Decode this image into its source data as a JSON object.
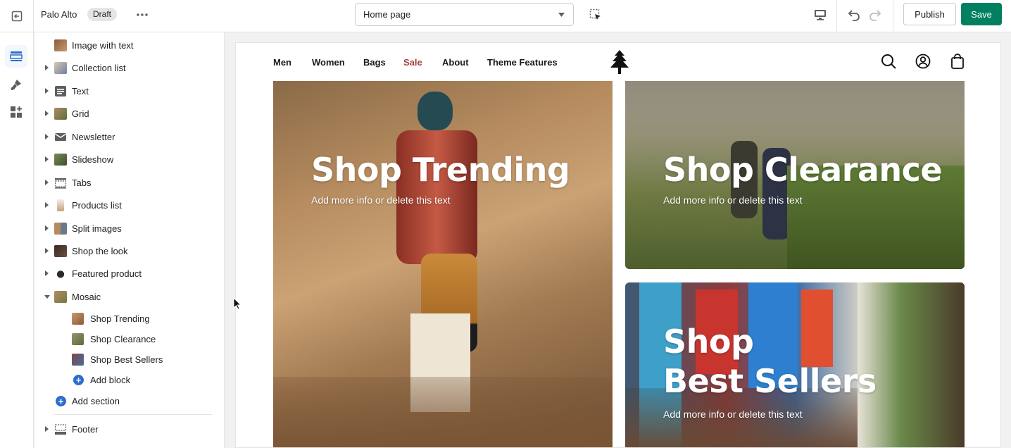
{
  "topbar": {
    "store_name": "Palo Alto",
    "draft_badge": "Draft",
    "page_select": "Home page",
    "publish_label": "Publish",
    "save_label": "Save"
  },
  "sidebar": {
    "items": [
      {
        "label": "Image with text",
        "expandable": false
      },
      {
        "label": "Collection list",
        "expandable": true
      },
      {
        "label": "Text",
        "expandable": true
      },
      {
        "label": "Grid",
        "expandable": true
      },
      {
        "label": "Newsletter",
        "expandable": true
      },
      {
        "label": "Slideshow",
        "expandable": true
      },
      {
        "label": "Tabs",
        "expandable": true
      },
      {
        "label": "Products list",
        "expandable": true
      },
      {
        "label": "Split images",
        "expandable": true
      },
      {
        "label": "Shop the look",
        "expandable": true
      },
      {
        "label": "Featured product",
        "expandable": true
      },
      {
        "label": "Mosaic",
        "expandable": true,
        "expanded": true
      }
    ],
    "mosaic_blocks": [
      "Shop Trending",
      "Shop Clearance",
      "Shop Best Sellers"
    ],
    "add_block": "Add block",
    "add_section": "Add section",
    "footer": "Footer"
  },
  "preview": {
    "nav": [
      "Men",
      "Women",
      "Bags",
      "Sale",
      "About",
      "Theme Features"
    ],
    "sale_color": "#a5423f",
    "tiles": [
      {
        "title": "Shop Trending",
        "subtitle": "Add more info or delete this text"
      },
      {
        "title": "Shop Clearance",
        "subtitle": "Add more info or delete this text"
      },
      {
        "title_line1": "Shop",
        "title_line2": "Best Sellers",
        "subtitle": "Add more info or delete this text"
      }
    ]
  },
  "colors": {
    "primary": "#008060",
    "link": "#2c6ecb"
  }
}
